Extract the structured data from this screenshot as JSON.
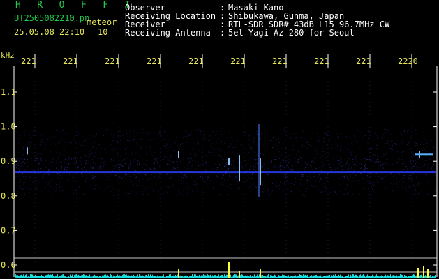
{
  "header": {
    "app_name": "HROFFT",
    "filename": "UT2505082210.pn",
    "datetime": "25.05.08 22:10",
    "index": "10",
    "target": "meteor",
    "fields": [
      {
        "label": "Observer",
        "value": "Masaki Kano"
      },
      {
        "label": "Receiving Location",
        "value": "Shibukawa, Gunma, Japan"
      },
      {
        "label": "Receiver",
        "value": "RTL-SDR SDR# 43dB L15 96.7MHz CW"
      },
      {
        "label": "Receiving Antenna",
        "value": "5el Yagi Az 280 for Seoul"
      }
    ]
  },
  "axes": {
    "y_unit": "kHz",
    "time_labels": [
      "221",
      "221",
      "221",
      "221",
      "221",
      "221",
      "221",
      "221",
      "221",
      "2220"
    ],
    "freq_ticks": [
      "1.1",
      "1.0",
      "0.9",
      "0.8",
      "0.7",
      "0.6"
    ]
  },
  "colors": {
    "background": "#000000",
    "header_green": "#22c84a",
    "header_yellow": "#e8e85a",
    "signal_blue": "#2a3cff",
    "meteor_echo": "#9fd0ff",
    "level_cyan": "#18e0e0",
    "level_yellow": "#ffff3a"
  },
  "spectrogram": {
    "carrier_freq_khz": 0.87,
    "meteor_echoes_khz": [
      0.93,
      0.92,
      0.9,
      0.88,
      0.87,
      0.92
    ]
  }
}
